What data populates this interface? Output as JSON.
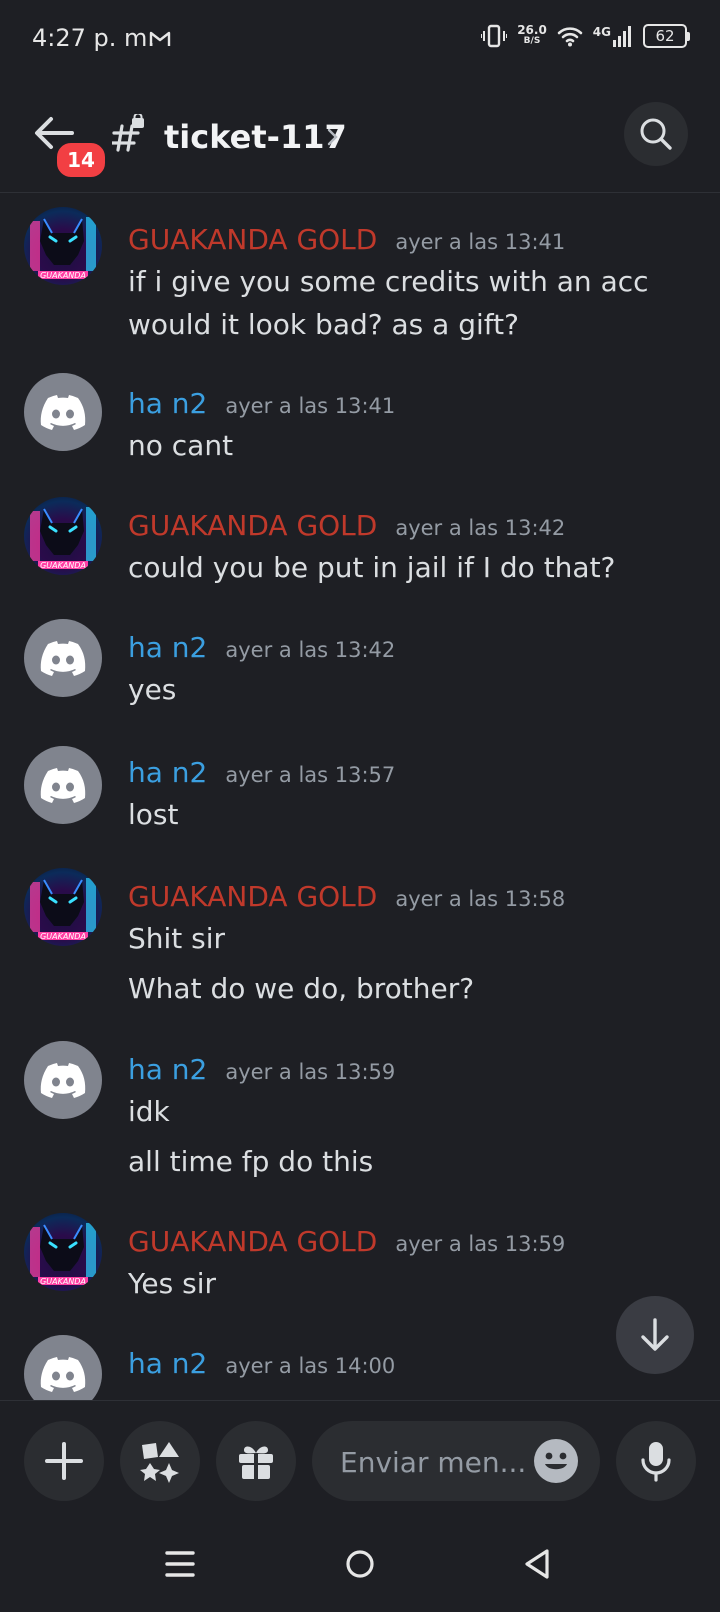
{
  "status_bar": {
    "time": "4:27 p. m.",
    "net_speed_value": "26.0",
    "net_speed_unit": "B/S",
    "network_type": "4G",
    "battery": "62"
  },
  "header": {
    "unread_badge": "14",
    "channel_name": "ticket-117"
  },
  "messages": [
    {
      "author": "GUAKANDA GOLD",
      "time": "ayer a las 13:41",
      "lines": [
        "if i give you some credits with an acc",
        "would it look bad? as a gift?"
      ]
    },
    {
      "author": "ha n2",
      "time": "ayer a las 13:41",
      "lines": [
        "no cant"
      ]
    },
    {
      "author": "GUAKANDA GOLD",
      "time": "ayer a las 13:42",
      "lines": [
        "could you be put in jail if I do that?"
      ]
    },
    {
      "author": "ha n2",
      "time": "ayer a las 13:42",
      "lines": [
        "yes"
      ]
    },
    {
      "author": "ha n2",
      "time": "ayer a las 13:57",
      "lines": [
        "lost"
      ]
    },
    {
      "author": "GUAKANDA GOLD",
      "time": "ayer a las 13:58",
      "lines": [
        "Shit sir",
        "What do we do, brother?"
      ]
    },
    {
      "author": "ha n2",
      "time": "ayer a las 13:59",
      "lines": [
        "idk",
        "all time fp do this"
      ]
    },
    {
      "author": "GUAKANDA GOLD",
      "time": "ayer a las 13:59",
      "lines": [
        "Yes sir"
      ]
    },
    {
      "author": "ha n2",
      "time": "ayer a las 14:00",
      "lines": []
    }
  ],
  "avatar_text": "GUAKANDA",
  "composer": {
    "placeholder": "Enviar men..."
  },
  "colors": {
    "background": "#1e1f24",
    "gold_user": "#c0392b",
    "blue_user": "#3b9fe0",
    "badge": "#f23f43"
  }
}
